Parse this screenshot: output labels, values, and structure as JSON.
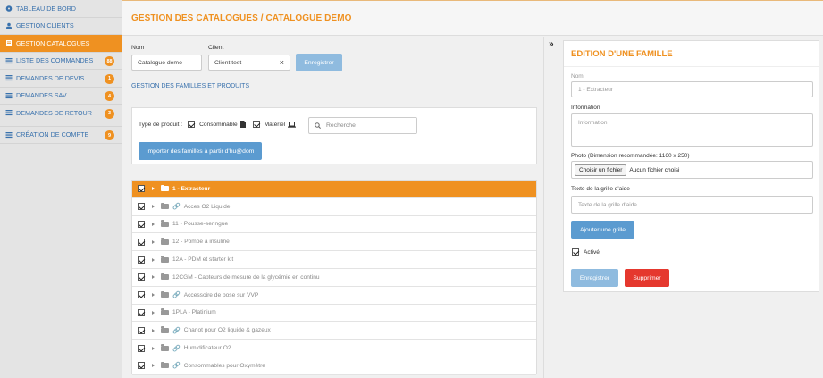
{
  "sidebar": {
    "items": [
      {
        "label": "TABLEAU DE BORD",
        "icon": "dashboard-icon"
      },
      {
        "label": "GESTION CLIENTS",
        "icon": "users-icon"
      },
      {
        "label": "GESTION CATALOGUES",
        "icon": "book-icon"
      },
      {
        "label": "LISTE DES COMMANDES",
        "icon": "list-icon",
        "badge": "88"
      },
      {
        "label": "DEMANDES DE DEVIS",
        "icon": "list-icon",
        "badge": "1"
      },
      {
        "label": "DEMANDES SAV",
        "icon": "list-icon",
        "badge": "4"
      },
      {
        "label": "DEMANDES DE RETOUR",
        "icon": "list-icon",
        "badge": "3"
      },
      {
        "label": "CRÉATION DE COMPTE",
        "icon": "list-icon",
        "badge": "9"
      }
    ]
  },
  "header": {
    "title": "GESTION DES CATALOGUES / CATALOGUE DEMO"
  },
  "form": {
    "nom_label": "Nom",
    "nom_value": "Catalogue demo",
    "client_label": "Client",
    "client_value": "Client test",
    "clear_symbol": "×",
    "save_label": "Enregistrer"
  },
  "section": {
    "families_title": "GESTION DES FAMILLES ET PRODUITS"
  },
  "filters": {
    "type_label": "Type de produit :",
    "consommable": "Consommable",
    "materiel": "Matériel",
    "search_placeholder": "Recherche",
    "import_label": "Importer des familles à partir d'hu@dom"
  },
  "tree": {
    "rows": [
      {
        "label": "1 - Extracteur",
        "link": false,
        "active": true
      },
      {
        "label": "Acces O2 Liquide",
        "link": true
      },
      {
        "label": "11 - Pousse-seringue",
        "link": false
      },
      {
        "label": "12 - Pompe à insuline",
        "link": false
      },
      {
        "label": "12A - PDM et starter kit",
        "link": false
      },
      {
        "label": "12CGM - Capteurs de mesure de la glycémie en continu",
        "link": false
      },
      {
        "label": "Accessoire de pose sur VVP",
        "link": true
      },
      {
        "label": "1PLA - Platinium",
        "link": false
      },
      {
        "label": "Chariot pour O2 liquide & gazeux",
        "link": true
      },
      {
        "label": "Humidificateur O2",
        "link": true
      },
      {
        "label": "Consommables pour Oxymètre",
        "link": true
      }
    ]
  },
  "panel": {
    "title": "EDITION D'UNE FAMILLE",
    "nom_placeholder": "Nom",
    "nom_value": "1 - Extracteur",
    "info_label": "Information",
    "info_placeholder": "Information",
    "photo_label": "Photo (Dimension recommandée: 1160 x 250)",
    "file_button": "Choisir un fichier",
    "file_status": "Aucun fichier choisi",
    "grid_label": "Texte de la grille d'aide",
    "grid_placeholder": "Texte de la grille d'aide",
    "add_grid": "Ajouter une grille",
    "active_label": "Activé",
    "save": "Enregistrer",
    "delete": "Supprimer"
  },
  "colors": {
    "accent": "#ef9121",
    "link": "#3a72ad",
    "button_blue": "#8fbbdf",
    "danger": "#e5382e"
  }
}
